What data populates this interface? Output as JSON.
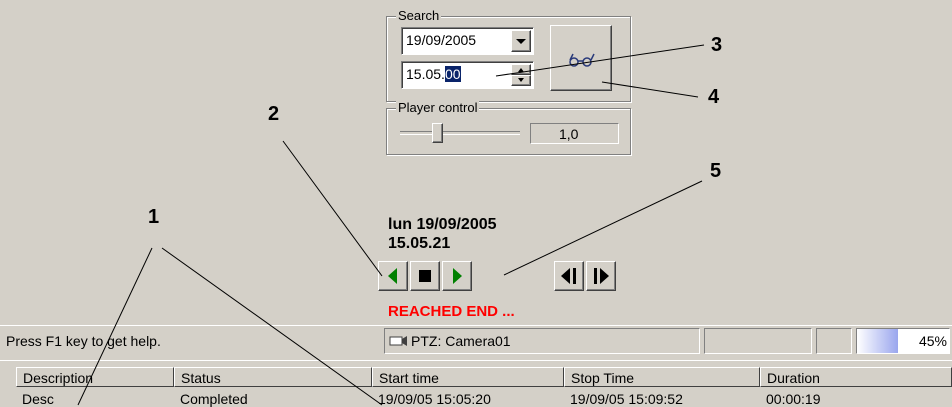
{
  "search": {
    "legend": "Search",
    "date_value": "19/09/2005",
    "time_prefix": "15.05.",
    "time_selected": "00"
  },
  "player": {
    "legend": "Player control",
    "speed_value": "1,0",
    "slider_position": 0.3
  },
  "playback": {
    "date_line": "lun 19/09/2005",
    "time_line": "15.05.21",
    "status": "REACHED END ...",
    "status_color": "#ff0000"
  },
  "callouts": [
    "1",
    "2",
    "3",
    "4",
    "5"
  ],
  "statusbar": {
    "help_text": "Press F1 key to get help.",
    "camera_text": "PTZ: Camera01",
    "progress_text": "45%",
    "progress_value": 0.45
  },
  "table": {
    "columns": [
      "Description",
      "Status",
      "Start time",
      "Stop Time",
      "Duration"
    ],
    "rows": [
      [
        "Desc",
        "Completed",
        "19/09/05 15:05:20",
        "19/09/05 15:09:52",
        "00:00:19"
      ]
    ]
  },
  "icons": {
    "find": "glasses-icon",
    "prev": "play-backward-icon",
    "stop": "stop-icon",
    "play": "play-icon",
    "frame_back": "frame-back-icon",
    "frame_fwd": "frame-forward-icon",
    "camera": "camera-icon"
  }
}
